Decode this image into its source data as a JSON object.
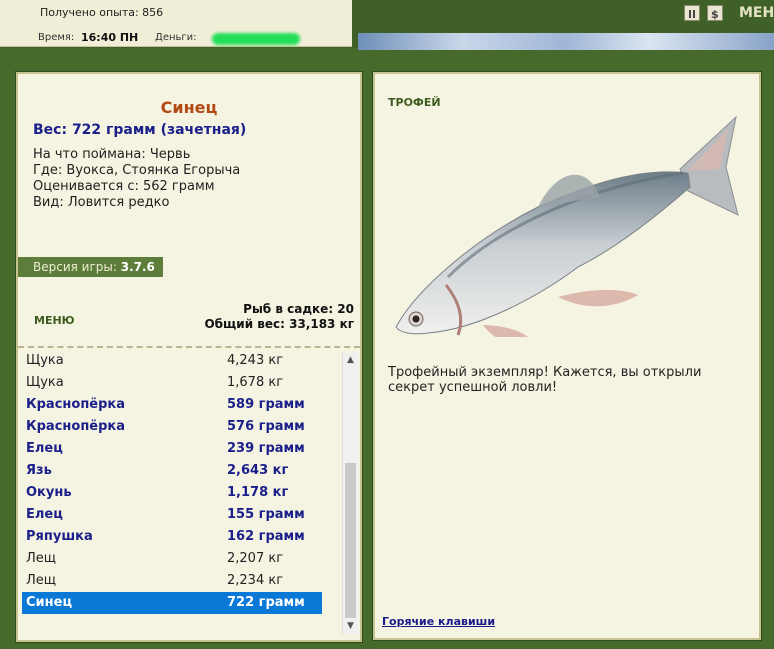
{
  "status": {
    "xp_text": "Получено опыта: 856",
    "time_label": "Время:",
    "time_value": "16:40 ПН",
    "money_label": "Деньги:"
  },
  "header": {
    "menu_label": "МЕНЮ"
  },
  "fish": {
    "name": "Синец",
    "weight": "Вес: 722 грамм (зачетная)",
    "bait": "На что поймана: Червь",
    "place": "Где: Вуокса, Стоянка Егорыча",
    "rated": "Оценивается с: 562 грамм",
    "species_status": "Вид: Ловится редко"
  },
  "version": {
    "label": "Версия игры:",
    "value": "3.7.6"
  },
  "left_menu_label": "МЕНЮ",
  "stats": {
    "count": "Рыб в садке: 20",
    "total": "Общий вес: 33,183 кг"
  },
  "catch_list": [
    {
      "name": "Щука",
      "weight": "4,243 кг",
      "color": "#222222",
      "bold": false
    },
    {
      "name": "Щука",
      "weight": "1,678 кг",
      "color": "#222222",
      "bold": false
    },
    {
      "name": "Краснопёрка",
      "weight": "589 грамм",
      "color": "#1a1f8a",
      "bold": true
    },
    {
      "name": "Краснопёрка",
      "weight": "576 грамм",
      "color": "#1a1f8a",
      "bold": true
    },
    {
      "name": "Елец",
      "weight": "239 грамм",
      "color": "#1a1f8a",
      "bold": true
    },
    {
      "name": "Язь",
      "weight": "2,643 кг",
      "color": "#1a1f8a",
      "bold": true
    },
    {
      "name": "Окунь",
      "weight": "1,178 кг",
      "color": "#1a1f8a",
      "bold": true
    },
    {
      "name": "Елец",
      "weight": "155 грамм",
      "color": "#1a1f8a",
      "bold": true
    },
    {
      "name": "Ряпушка",
      "weight": "162 грамм",
      "color": "#1a1f8a",
      "bold": true
    },
    {
      "name": "Лещ",
      "weight": "2,207 кг",
      "color": "#222222",
      "bold": false
    },
    {
      "name": "Лещ",
      "weight": "2,234 кг",
      "color": "#222222",
      "bold": false
    },
    {
      "name": "Синец",
      "weight": "722 грамм",
      "color": "#ffffff",
      "bold": true,
      "selected": true
    }
  ],
  "trophy": {
    "label": "ТРОФЕЙ",
    "description": "Трофейный экземпляр! Кажется, вы открыли секрет успешной ловли!",
    "hotkeys": "Горячие клавиши"
  },
  "icons": {
    "pause": "pause-icon",
    "stats": "stats-icon",
    "fish": "fish-image"
  }
}
